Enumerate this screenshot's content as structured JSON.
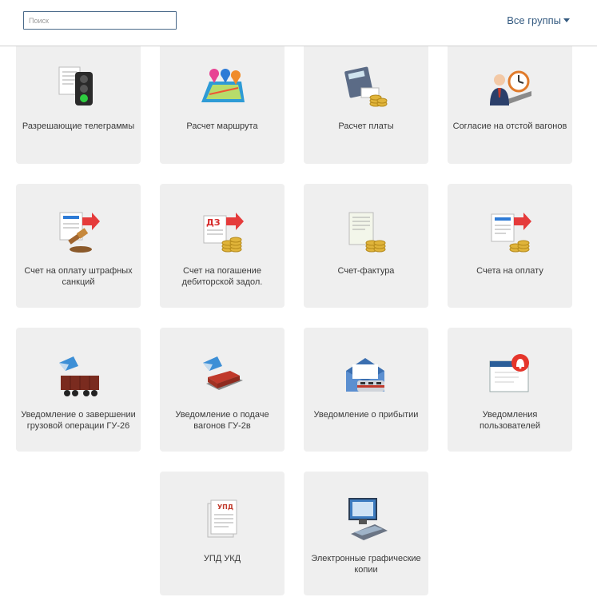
{
  "search": {
    "placeholder": "Поиск",
    "value": ""
  },
  "groups_dropdown": {
    "label": "Все группы"
  },
  "tiles": [
    {
      "label": "Разрешающие телеграммы",
      "icon": "traffic-light-document-icon"
    },
    {
      "label": "Расчет маршрута",
      "icon": "route-map-icon"
    },
    {
      "label": "Расчет платы",
      "icon": "calculator-coins-icon"
    },
    {
      "label": "Согласие на отстой вагонов",
      "icon": "manager-clock-icon"
    },
    {
      "label": "Счет на оплату штрафных санкций",
      "icon": "invoice-gavel-icon"
    },
    {
      "label": "Счет на погашение дебиторской задол.",
      "icon": "invoice-dz-coins-icon"
    },
    {
      "label": "Счет-фактура",
      "icon": "invoice-coins-icon"
    },
    {
      "label": "Счета на оплату",
      "icon": "invoice-arrow-coins-icon"
    },
    {
      "label": "Уведомление о завершении грузовой операции ГУ-26",
      "icon": "freight-wagon-notice-icon"
    },
    {
      "label": "Уведомление о подаче вагонов ГУ-2в",
      "icon": "railcar-notice-icon"
    },
    {
      "label": "Уведомление о прибытии",
      "icon": "envelope-train-icon"
    },
    {
      "label": "Уведомления пользователей",
      "icon": "window-bell-icon"
    },
    {
      "label": "УПД УКД",
      "icon": "upd-document-icon",
      "badge": "УПД"
    },
    {
      "label": "Электронные графические копии",
      "icon": "scanner-monitor-icon"
    }
  ]
}
